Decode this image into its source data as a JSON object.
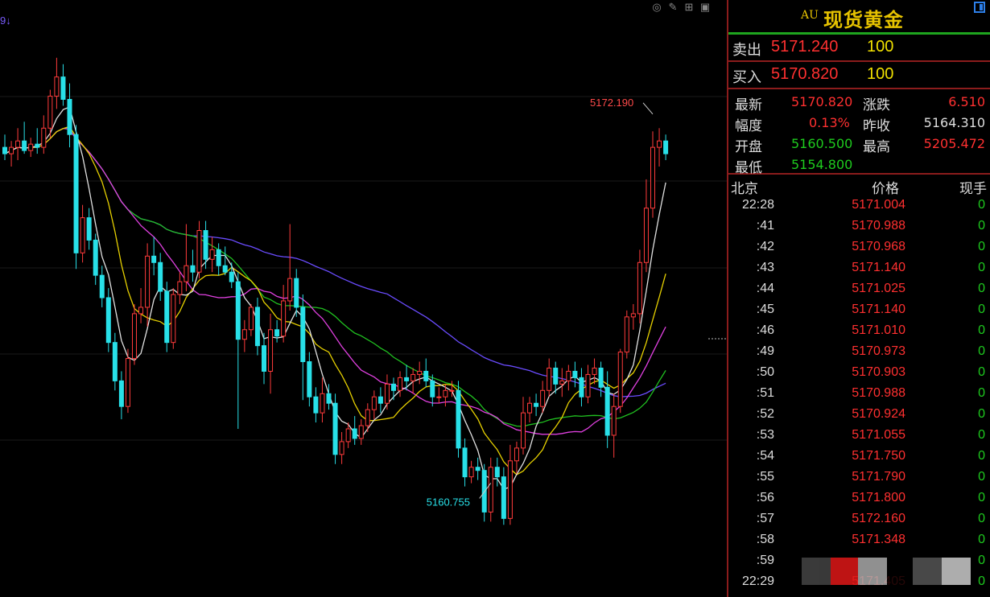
{
  "corner_tag": "9↓",
  "chart_data": {
    "type": "candlestick",
    "ylim": [
      5158.2,
      5174.8
    ],
    "colors": {
      "up": "#ff3b3b",
      "down": "#28e0e8",
      "ma5": "#e0e0e0",
      "ma10": "#e6d000",
      "ma20": "#e040e0",
      "ma30": "#20c020",
      "ma60": "#6a4cff"
    },
    "candles": [
      [
        5171.2,
        5171.6,
        5170.8,
        5171.0
      ],
      [
        5171.0,
        5171.4,
        5170.6,
        5171.2
      ],
      [
        5171.2,
        5171.8,
        5170.8,
        5171.4
      ],
      [
        5171.4,
        5172.0,
        5171.0,
        5171.1
      ],
      [
        5171.1,
        5171.5,
        5170.9,
        5171.3
      ],
      [
        5171.3,
        5171.8,
        5171.0,
        5171.2
      ],
      [
        5171.2,
        5172.2,
        5171.0,
        5171.8
      ],
      [
        5171.8,
        5173.0,
        5171.5,
        5172.8
      ],
      [
        5172.8,
        5174.0,
        5172.4,
        5173.4
      ],
      [
        5173.4,
        5173.8,
        5172.5,
        5172.7
      ],
      [
        5172.7,
        5173.2,
        5171.2,
        5171.6
      ],
      [
        5171.6,
        5171.9,
        5167.4,
        5167.9
      ],
      [
        5167.9,
        5169.4,
        5167.6,
        5169.0
      ],
      [
        5169.0,
        5169.3,
        5168.0,
        5168.3
      ],
      [
        5168.3,
        5168.5,
        5166.9,
        5167.2
      ],
      [
        5167.2,
        5167.5,
        5166.2,
        5166.5
      ],
      [
        5166.5,
        5166.8,
        5164.8,
        5165.1
      ],
      [
        5165.1,
        5165.4,
        5163.6,
        5163.9
      ],
      [
        5163.9,
        5164.2,
        5162.7,
        5163.1
      ],
      [
        5163.1,
        5164.9,
        5162.9,
        5164.6
      ],
      [
        5164.6,
        5166.3,
        5164.4,
        5166.0
      ],
      [
        5166.0,
        5166.8,
        5165.7,
        5166.2
      ],
      [
        5166.2,
        5168.2,
        5165.6,
        5167.8
      ],
      [
        5167.8,
        5168.4,
        5167.2,
        5167.6
      ],
      [
        5167.6,
        5167.9,
        5166.4,
        5166.7
      ],
      [
        5166.7,
        5167.0,
        5164.8,
        5165.1
      ],
      [
        5165.1,
        5166.8,
        5164.9,
        5166.6
      ],
      [
        5166.6,
        5167.3,
        5166.3,
        5167.0
      ],
      [
        5167.0,
        5168.8,
        5166.7,
        5167.5
      ],
      [
        5167.5,
        5168.0,
        5167.0,
        5167.3
      ],
      [
        5167.3,
        5168.9,
        5167.1,
        5168.6
      ],
      [
        5168.6,
        5168.9,
        5167.4,
        5167.7
      ],
      [
        5167.7,
        5168.4,
        5167.3,
        5168.0
      ],
      [
        5168.0,
        5168.2,
        5167.2,
        5167.5
      ],
      [
        5167.5,
        5168.1,
        5167.2,
        5167.3
      ],
      [
        5167.3,
        5167.6,
        5166.8,
        5167.0
      ],
      [
        5167.0,
        5167.3,
        5162.4,
        5165.2
      ],
      [
        5165.2,
        5165.8,
        5164.8,
        5165.5
      ],
      [
        5165.5,
        5166.3,
        5165.3,
        5166.2
      ],
      [
        5166.2,
        5166.5,
        5164.7,
        5165.0
      ],
      [
        5165.0,
        5165.4,
        5163.8,
        5164.2
      ],
      [
        5164.2,
        5166.0,
        5163.5,
        5165.5
      ],
      [
        5165.5,
        5165.8,
        5165.1,
        5165.3
      ],
      [
        5165.3,
        5166.9,
        5165.1,
        5166.4
      ],
      [
        5166.4,
        5168.8,
        5166.1,
        5167.1
      ],
      [
        5167.1,
        5167.4,
        5165.9,
        5166.2
      ],
      [
        5166.2,
        5166.6,
        5163.3,
        5164.5
      ],
      [
        5164.5,
        5164.8,
        5163.1,
        5163.4
      ],
      [
        5163.4,
        5163.7,
        5162.6,
        5162.9
      ],
      [
        5162.9,
        5164.0,
        5162.6,
        5163.5
      ],
      [
        5163.5,
        5163.8,
        5163.0,
        5163.2
      ],
      [
        5163.2,
        5163.5,
        5161.3,
        5161.6
      ],
      [
        5161.6,
        5162.3,
        5161.3,
        5162.0
      ],
      [
        5162.0,
        5162.6,
        5161.8,
        5162.4
      ],
      [
        5162.4,
        5162.8,
        5161.9,
        5162.1
      ],
      [
        5162.1,
        5162.7,
        5161.9,
        5162.5
      ],
      [
        5162.5,
        5163.2,
        5162.3,
        5163.0
      ],
      [
        5163.0,
        5163.6,
        5162.7,
        5163.4
      ],
      [
        5163.4,
        5163.7,
        5162.9,
        5163.2
      ],
      [
        5163.2,
        5164.1,
        5163.0,
        5163.8
      ],
      [
        5163.8,
        5164.0,
        5163.3,
        5163.6
      ],
      [
        5163.6,
        5164.2,
        5163.4,
        5164.0
      ],
      [
        5164.0,
        5164.4,
        5163.6,
        5163.9
      ],
      [
        5163.9,
        5164.3,
        5163.5,
        5164.1
      ],
      [
        5164.1,
        5164.5,
        5163.8,
        5164.2
      ],
      [
        5164.2,
        5164.6,
        5163.7,
        5163.9
      ],
      [
        5163.9,
        5164.1,
        5163.1,
        5163.4
      ],
      [
        5163.4,
        5163.7,
        5163.2,
        5163.4
      ],
      [
        5163.4,
        5163.8,
        5163.1,
        5163.6
      ],
      [
        5163.6,
        5163.9,
        5163.4,
        5163.6
      ],
      [
        5163.6,
        5163.9,
        5161.5,
        5161.8
      ],
      [
        5161.8,
        5162.1,
        5160.6,
        5160.9
      ],
      [
        5160.9,
        5161.4,
        5160.7,
        5161.2
      ],
      [
        5161.2,
        5161.5,
        5160.8,
        5161.1
      ],
      [
        5161.1,
        5161.3,
        5159.5,
        5159.8
      ],
      [
        5159.8,
        5161.5,
        5159.5,
        5161.2
      ],
      [
        5161.2,
        5161.5,
        5160.6,
        5160.9
      ],
      [
        5160.9,
        5161.2,
        5159.4,
        5159.6
      ],
      [
        5159.6,
        5161.9,
        5159.4,
        5161.4
      ],
      [
        5161.4,
        5162.0,
        5161.0,
        5161.8
      ],
      [
        5161.8,
        5163.4,
        5161.6,
        5162.9
      ],
      [
        5162.9,
        5163.4,
        5162.6,
        5163.2
      ],
      [
        5163.2,
        5163.5,
        5162.8,
        5163.1
      ],
      [
        5163.1,
        5163.9,
        5162.9,
        5163.6
      ],
      [
        5163.6,
        5164.6,
        5163.4,
        5164.3
      ],
      [
        5164.3,
        5164.5,
        5163.5,
        5163.8
      ],
      [
        5163.8,
        5164.3,
        5163.4,
        5163.9
      ],
      [
        5163.9,
        5164.4,
        5163.6,
        5164.2
      ],
      [
        5164.2,
        5164.5,
        5163.7,
        5164.0
      ],
      [
        5164.0,
        5164.3,
        5163.1,
        5163.4
      ],
      [
        5163.4,
        5164.4,
        5163.2,
        5164.1
      ],
      [
        5164.1,
        5164.6,
        5163.8,
        5164.3
      ],
      [
        5164.3,
        5164.5,
        5163.4,
        5163.7
      ],
      [
        5163.7,
        5164.2,
        5161.8,
        5162.2
      ],
      [
        5162.2,
        5163.5,
        5161.5,
        5163.1
      ],
      [
        5163.1,
        5164.9,
        5162.9,
        5164.8
      ],
      [
        5164.8,
        5166.1,
        5164.6,
        5165.9
      ],
      [
        5165.9,
        5166.3,
        5165.5,
        5166.0
      ],
      [
        5166.0,
        5168.0,
        5165.7,
        5167.6
      ],
      [
        5167.6,
        5170.2,
        5167.3,
        5169.3
      ],
      [
        5169.3,
        5171.7,
        5169.0,
        5171.2
      ],
      [
        5171.2,
        5171.8,
        5170.6,
        5171.4
      ],
      [
        5171.4,
        5171.6,
        5170.8,
        5171.0
      ]
    ],
    "annotations": [
      {
        "label": "5172.190",
        "color": "#ff4a4a",
        "at_index": 100,
        "value": 5172.19
      },
      {
        "label": "5160.755",
        "color": "#28e0e8",
        "at_index": 75,
        "value": 5160.755
      }
    ]
  },
  "panel": {
    "symbol_tag": "AU",
    "title": "现货黄金",
    "sell_label": "卖出",
    "sell_price": "5171.240",
    "sell_vol": "100",
    "buy_label": "买入",
    "buy_price": "5170.820",
    "buy_vol": "100",
    "stats": {
      "latest_label": "最新",
      "latest": "5170.820",
      "change_label": "涨跌",
      "change": "6.510",
      "range_label": "幅度",
      "range": "0.13%",
      "prev_label": "昨收",
      "prev": "5164.310",
      "open_label": "开盘",
      "open": "5160.500",
      "high_label": "最高",
      "high": "5205.472",
      "low_label": "最低",
      "low": "5154.800"
    },
    "ticks_header": {
      "time": "北京",
      "price": "价格",
      "vol": "现手"
    },
    "ticks": [
      {
        "t": "22:28",
        "p": "5171.004",
        "v": "0"
      },
      {
        "t": ":41",
        "p": "5170.988",
        "v": "0"
      },
      {
        "t": ":42",
        "p": "5170.968",
        "v": "0"
      },
      {
        "t": ":43",
        "p": "5171.140",
        "v": "0"
      },
      {
        "t": ":44",
        "p": "5171.025",
        "v": "0"
      },
      {
        "t": ":45",
        "p": "5171.140",
        "v": "0"
      },
      {
        "t": ":46",
        "p": "5171.010",
        "v": "0"
      },
      {
        "t": ":49",
        "p": "5170.973",
        "v": "0"
      },
      {
        "t": ":50",
        "p": "5170.903",
        "v": "0"
      },
      {
        "t": ":51",
        "p": "5170.988",
        "v": "0"
      },
      {
        "t": ":52",
        "p": "5170.924",
        "v": "0"
      },
      {
        "t": ":53",
        "p": "5171.055",
        "v": "0"
      },
      {
        "t": ":54",
        "p": "5171.750",
        "v": "0"
      },
      {
        "t": ":55",
        "p": "5171.790",
        "v": "0"
      },
      {
        "t": ":56",
        "p": "5171.800",
        "v": "0"
      },
      {
        "t": ":57",
        "p": "5172.160",
        "v": "0"
      },
      {
        "t": ":58",
        "p": "5171.348",
        "v": "0"
      },
      {
        "t": ":59",
        "p": "",
        "v": "0"
      },
      {
        "t": "22:29",
        "p": "5171.405",
        "v": "0"
      }
    ]
  }
}
